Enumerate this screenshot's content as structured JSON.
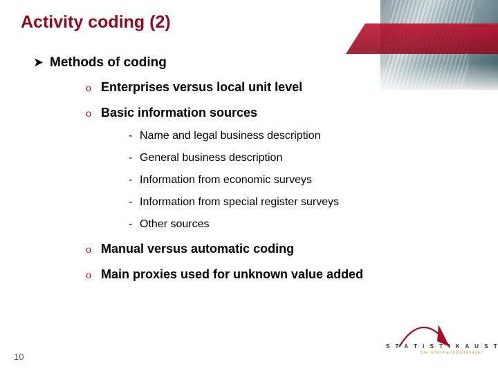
{
  "title": "Activity coding (2)",
  "page_number": "10",
  "bullets": {
    "lvl1_marker": "➤",
    "lvl2_marker": "o",
    "lvl3_marker": "-",
    "lvl1": "Methods of coding",
    "lvl2": {
      "a": "Enterprises versus local unit level",
      "b": "Basic information sources",
      "c": "Manual versus automatic coding",
      "d": "Main proxies used for unknown value added"
    },
    "lvl3": {
      "a": "Name and legal business description",
      "b": "General business description",
      "c": "Information from economic surveys",
      "d": "Information from special register surveys",
      "e": "Other sources"
    }
  },
  "logo": {
    "main": "S T A T I S T I K   A U S T R I A",
    "sub": "Die Informationsmanager"
  },
  "colors": {
    "accent": "#8f0a20"
  }
}
